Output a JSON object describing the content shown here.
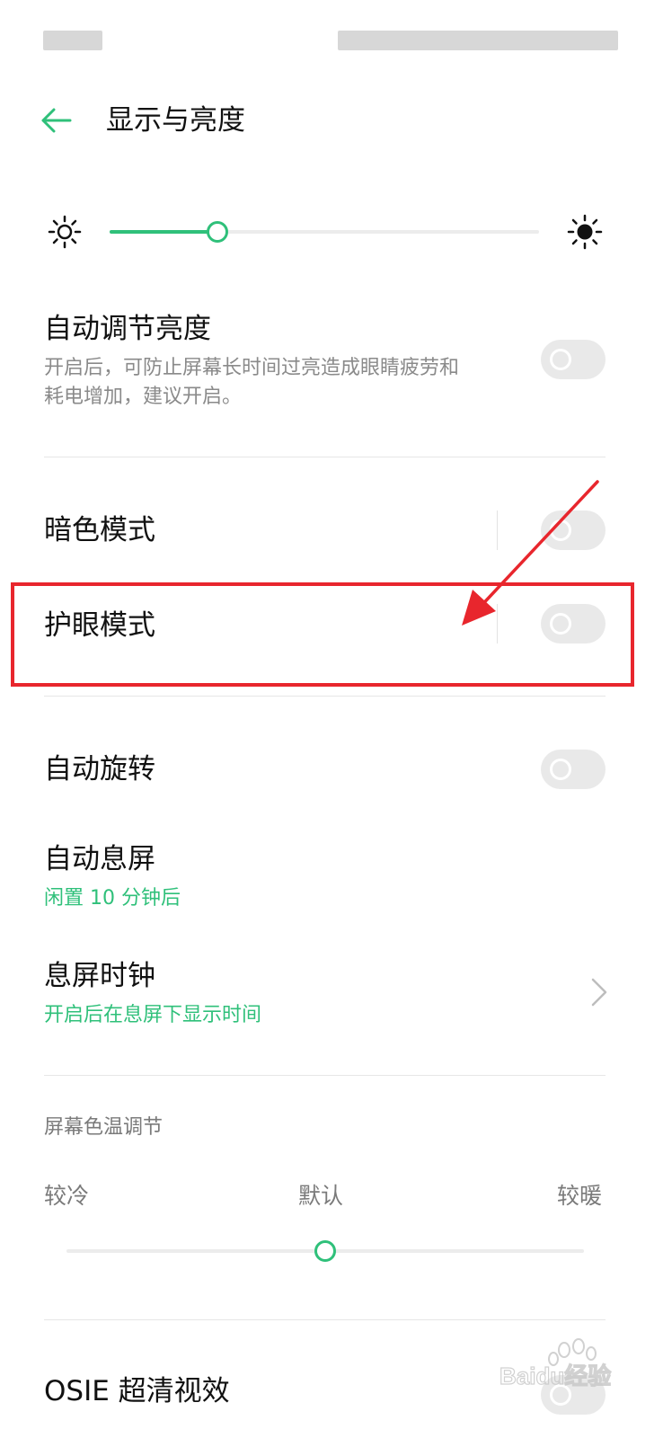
{
  "header": {
    "title": "显示与亮度"
  },
  "brightness": {
    "level_percent": 25
  },
  "settings": {
    "auto_brightness": {
      "title": "自动调节亮度",
      "desc_line1": "开启后，可防止屏幕长时间过亮造成眼睛疲劳和",
      "desc_line2": "耗电增加，建议开启。",
      "enabled": false
    },
    "dark_mode": {
      "title": "暗色模式",
      "enabled": false
    },
    "eye_care": {
      "title": "护眼模式",
      "enabled": false
    },
    "auto_rotate": {
      "title": "自动旋转",
      "enabled": false
    },
    "auto_sleep": {
      "title": "自动息屏",
      "value": "闲置 10 分钟后"
    },
    "aod_clock": {
      "title": "息屏时钟",
      "desc": "开启后在息屏下显示时间"
    },
    "color_temp": {
      "section_label": "屏幕色温调节",
      "cold_label": "较冷",
      "default_label": "默认",
      "warm_label": "较暖",
      "level_percent": 50
    },
    "osie": {
      "title": "OSIE 超清视效"
    }
  },
  "colors": {
    "accent_green": "#2fc07a",
    "annotation_red": "#e8262d"
  },
  "watermark": {
    "text": "Baidu经验"
  }
}
